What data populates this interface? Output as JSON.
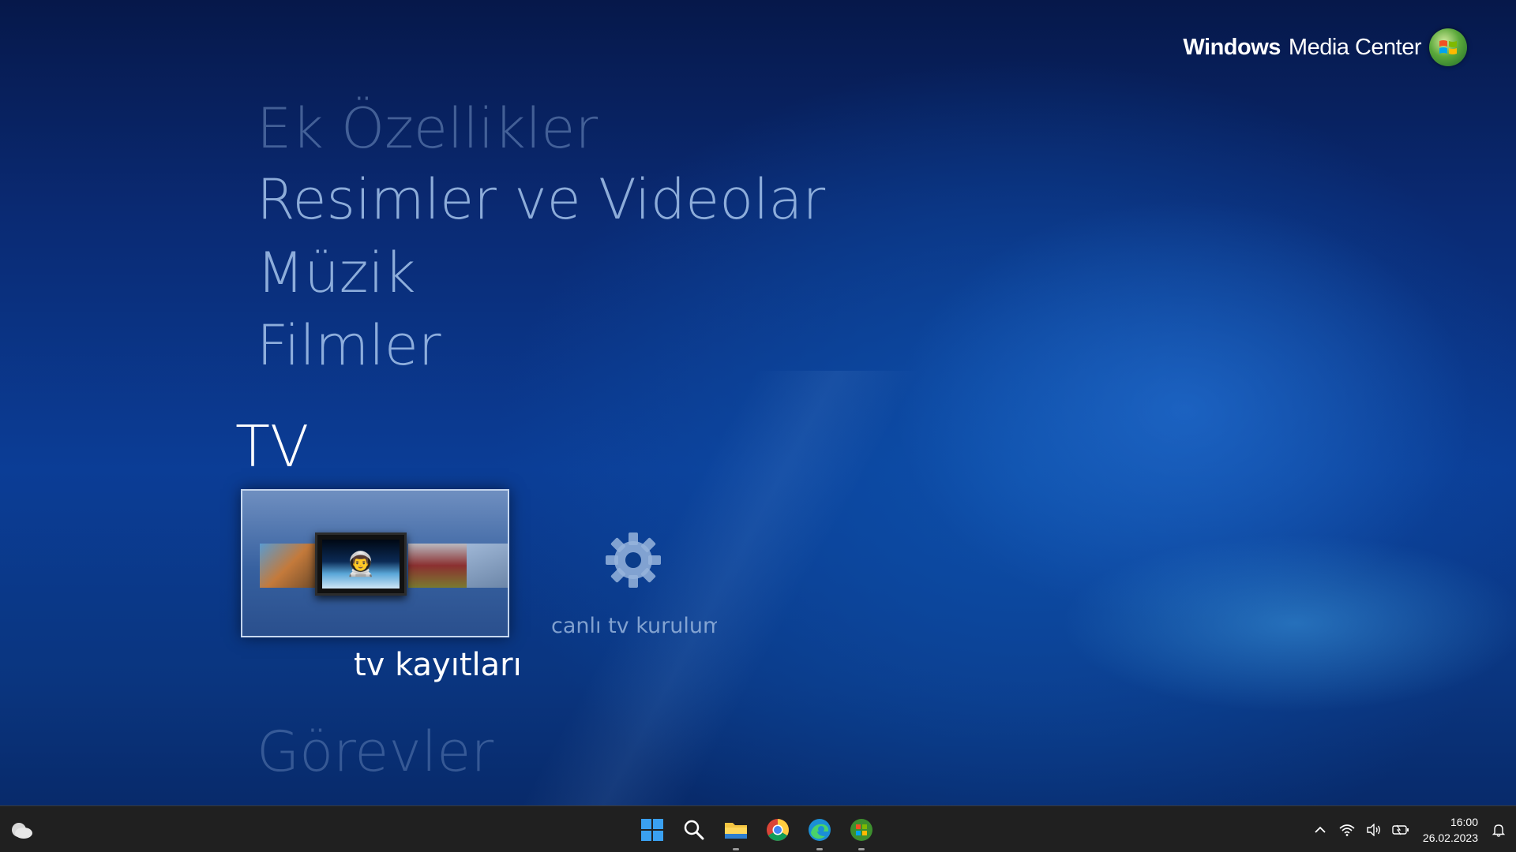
{
  "brand": {
    "bold": "Windows",
    "regular": "Media Center"
  },
  "menu": {
    "ek": "Ek Özellikler",
    "resimler": "Resimler ve Videolar",
    "muzik": "Müzik",
    "filmler": "Filmler",
    "tv": "TV",
    "gorevler": "Görevler"
  },
  "tv_strip": {
    "recorded_tv": "tv kayıtları",
    "live_tv_setup": "canlı tv kurulumu"
  },
  "taskbar": {
    "time": "16:00",
    "date": "26.02.2023",
    "apps": [
      "start-icon",
      "search-icon",
      "file-explorer-icon",
      "chrome-icon",
      "edge-icon",
      "media-center-icon"
    ]
  },
  "colors": {
    "accent_blue": "#0b3d96",
    "taskbar": "#202020"
  }
}
